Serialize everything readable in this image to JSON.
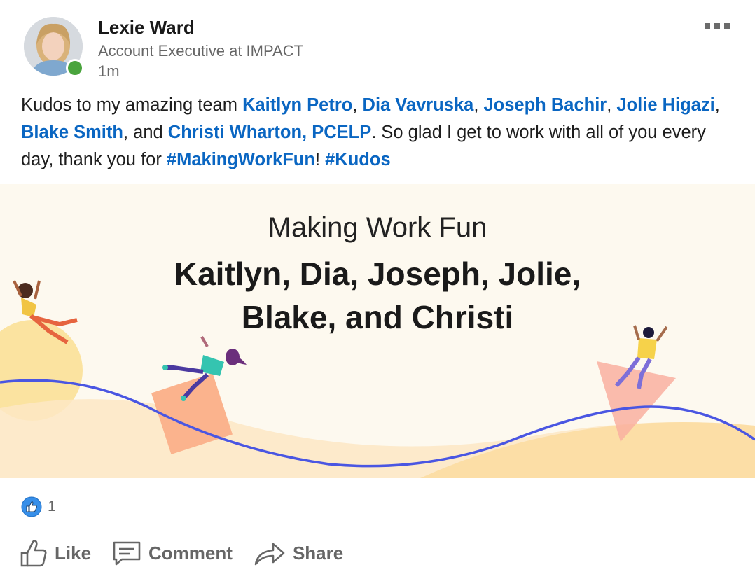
{
  "author": {
    "name": "Lexie Ward",
    "headline": "Account Executive at IMPACT",
    "time": "1m"
  },
  "post": {
    "intro": "Kudos to my amazing team ",
    "mentions": [
      "Kaitlyn Petro",
      "Dia Vavruska",
      "Joseph Bachir",
      "Jolie Higazi",
      "Blake Smith",
      "Christi Wharton, PCELP"
    ],
    "sep1": ", ",
    "sep2": ", ",
    "sep3": ", ",
    "sep4": ", ",
    "sep5": ", and ",
    "middle": ". So glad I get to work with all of you every day, thank you for ",
    "hashtag1": "#MakingWorkFun",
    "between_hashtags": "! ",
    "hashtag2": "#Kudos"
  },
  "image": {
    "subtitle": "Making Work Fun",
    "title_line1": "Kaitlyn, Dia, Joseph, Jolie,",
    "title_line2": "Blake, and Christi"
  },
  "reactions": {
    "icon": "like-reaction-icon",
    "count": "1"
  },
  "actions": {
    "like": "Like",
    "comment": "Comment",
    "share": "Share"
  },
  "colors": {
    "link": "#0a66c2",
    "presence": "#4aa43d",
    "banner_bg": "#fdf9ef",
    "wave": "#4a56e2"
  }
}
